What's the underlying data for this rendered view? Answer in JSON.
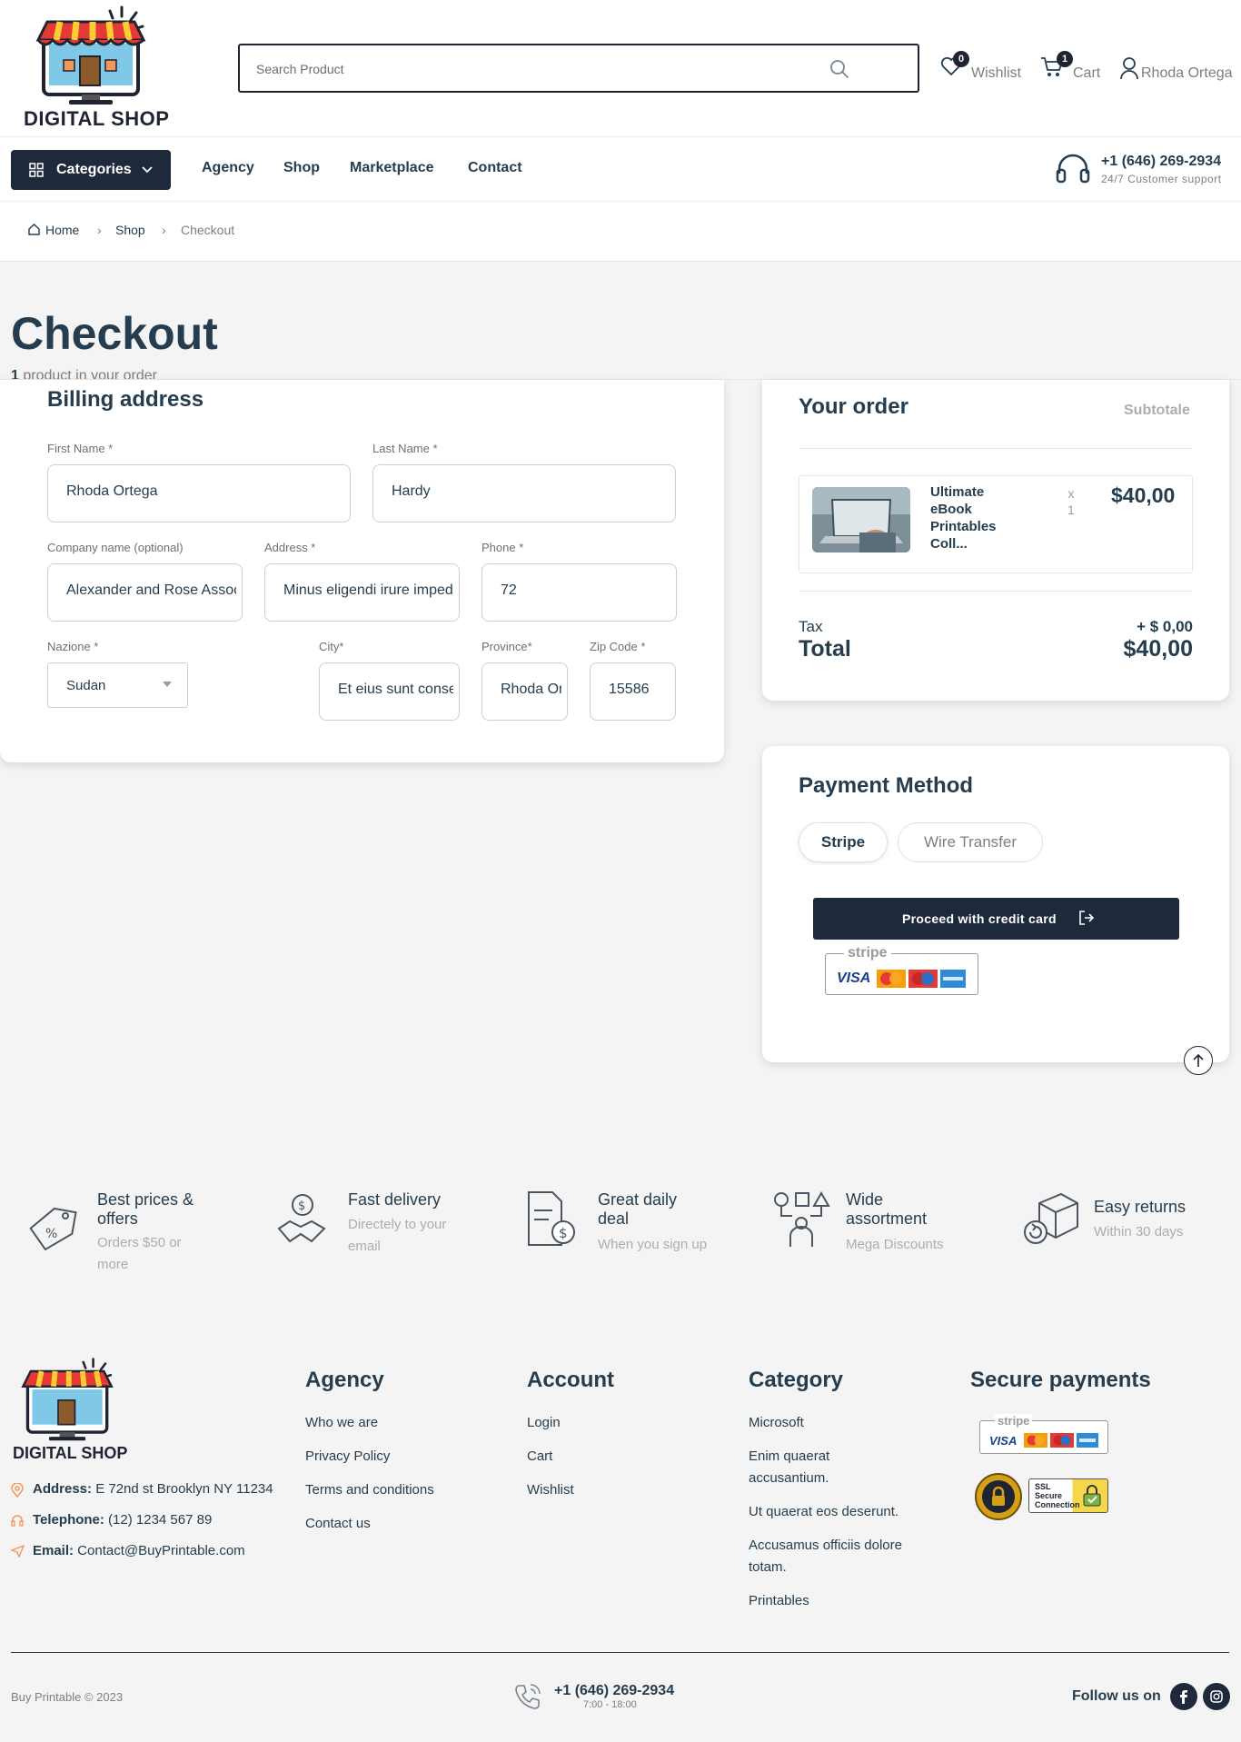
{
  "header": {
    "logo_text": "DIGITAL SHOP",
    "search_placeholder": "Search Product",
    "wishlist_label": "Wishlist",
    "wishlist_count": "0",
    "cart_label": "Cart",
    "cart_count": "1",
    "user_name": "Rhoda Ortega"
  },
  "nav": {
    "categories_label": "Categories",
    "links": [
      "Agency",
      "Shop",
      "Marketplace",
      "Contact"
    ],
    "phone": "+1 (646) 269-2934",
    "support": "24/7 Customer support"
  },
  "breadcrumb": [
    "Home",
    "Shop",
    "Checkout"
  ],
  "page": {
    "title": "Checkout",
    "subtitle_count": "1",
    "subtitle_rest": " product in your order"
  },
  "billing": {
    "heading": "Billing address",
    "first_name_label": "First Name *",
    "first_name": "Rhoda Ortega",
    "last_name_label": "Last Name *",
    "last_name": "Hardy",
    "company_label": "Company name (optional)",
    "company": "Alexander and Rose Associates",
    "address_label": "Address *",
    "address": "Minus eligendi irure impedit",
    "phone_label": "Phone *",
    "phone": "72",
    "country_label": "Nazione *",
    "country": "Sudan",
    "city_label": "City*",
    "city": "Et eius sunt consequat",
    "province_label": "Province*",
    "province": "Rhoda Ortega",
    "zip_label": "Zip Code *",
    "zip": "15586"
  },
  "order": {
    "heading": "Your order",
    "subtotal_label": "Subtotale",
    "item_name": "Ultimate eBook Printables Coll...",
    "item_name_lines": [
      "Ultimate",
      "eBook",
      "Printables",
      "Coll..."
    ],
    "item_qty_x": "x",
    "item_qty": "1",
    "item_price": "$40,00",
    "tax_label": "Tax",
    "tax_value": "+ $ 0,00",
    "total_label": "Total",
    "total_value": "$40,00"
  },
  "payment": {
    "heading": "Payment Method",
    "tab_stripe": "Stripe",
    "tab_wire": "Wire Transfer",
    "proceed_label": "Proceed with credit card",
    "stripe_word": "stripe",
    "visa": "VISA"
  },
  "features": [
    {
      "title": "Best prices & offers",
      "lines": [
        "Best prices &",
        "offers"
      ],
      "sub": [
        "Orders $50 or",
        "more"
      ]
    },
    {
      "title": "Fast delivery",
      "lines": [
        "Fast delivery"
      ],
      "sub": [
        "Directely to your",
        "email"
      ]
    },
    {
      "title": "Great daily deal",
      "lines": [
        "Great daily",
        "deal"
      ],
      "sub": [
        "When you sign up"
      ]
    },
    {
      "title": "Wide assortment",
      "lines": [
        "Wide",
        "assortment"
      ],
      "sub": [
        "Mega Discounts"
      ]
    },
    {
      "title": "Easy returns",
      "lines": [
        "Easy returns"
      ],
      "sub": [
        "Within 30 days"
      ]
    }
  ],
  "footer": {
    "logo_text": "DIGITAL SHOP",
    "address_label": "Address:",
    "address": " E 72nd st Brooklyn NY 11234",
    "telephone_label": "Telephone:",
    "telephone": " (12) 1234 567 89",
    "email_label": "Email:",
    "email": " Contact@BuyPrintable.com",
    "agency_heading": "Agency",
    "agency_links": [
      "Who we are",
      "Privacy Policy",
      "Terms and conditions",
      "Contact us"
    ],
    "account_heading": "Account",
    "account_links": [
      "Login",
      "Cart",
      "Wishlist"
    ],
    "category_heading": "Category",
    "category_links": [
      "Microsoft",
      "Enim quaerat accusantium.",
      "Ut quaerat eos deserunt.",
      "Accusamus officiis dolore totam.",
      "Printables"
    ],
    "category_lines": [
      [
        "Microsoft"
      ],
      [
        "Enim quaerat",
        "accusantium."
      ],
      [
        "Ut quaerat eos deserunt."
      ],
      [
        "Accusamus officiis dolore",
        "totam."
      ],
      [
        "Printables"
      ]
    ],
    "secure_heading": "Secure payments",
    "ssl_text": "SSL Secure Connection",
    "ssl_lines": [
      "SSL",
      "Secure",
      "Connection"
    ],
    "copyright": "Buy Printable © 2023",
    "phone": "+1 (646) 269-2934",
    "hours": "7:00 - 18:00",
    "follow": "Follow us on"
  },
  "colors": {
    "dark": "#1e2a3b",
    "text": "#253d4e",
    "muted": "#adadad",
    "accent_orange": "#f59758"
  }
}
